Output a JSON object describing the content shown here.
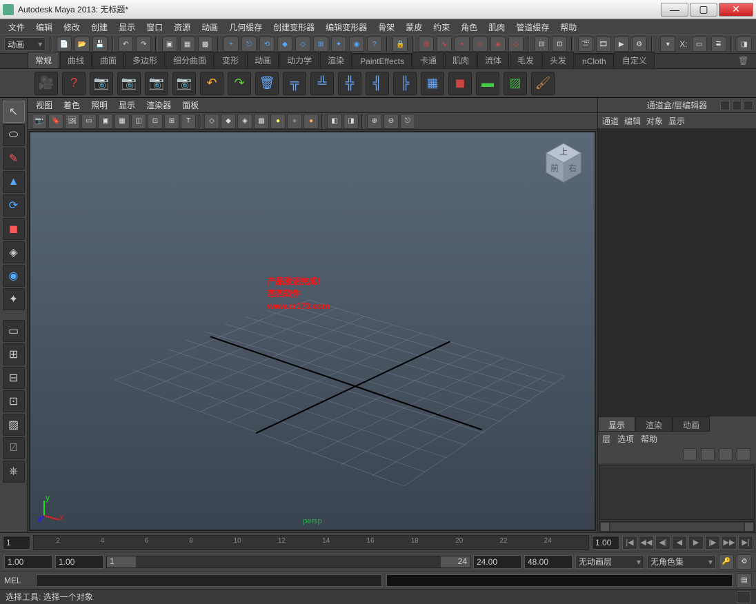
{
  "title": "Autodesk Maya 2013: 无标题*",
  "menu": [
    "文件",
    "编辑",
    "修改",
    "创建",
    "显示",
    "窗口",
    "资源",
    "动画",
    "几何缓存",
    "创建变形器",
    "编辑变形器",
    "骨架",
    "蒙皮",
    "约束",
    "角色",
    "肌肉",
    "管道缓存",
    "帮助"
  ],
  "modeCombo": "动画",
  "shelfTabs": [
    "常规",
    "曲线",
    "曲面",
    "多边形",
    "细分曲面",
    "变形",
    "动画",
    "动力学",
    "渲染",
    "PaintEffects",
    "卡通",
    "肌肉",
    "流体",
    "毛发",
    "头发",
    "nCloth",
    "自定义"
  ],
  "activeShelfTab": 0,
  "panelMenu": [
    "视图",
    "着色",
    "照明",
    "显示",
    "渲染器",
    "面板"
  ],
  "overlay": {
    "l1": "产品激活完成！",
    "l2": "西西软件",
    "l3": "www.cr173.com"
  },
  "perspLabel": "persp",
  "channelTitle": "通道盒/层编辑器",
  "channelTabs": [
    "通道",
    "编辑",
    "对象",
    "显示"
  ],
  "layerTabs": [
    "显示",
    "渲染",
    "动画"
  ],
  "activeLayerTab": 0,
  "layerMenu": [
    "层",
    "选项",
    "帮助"
  ],
  "timeline": {
    "start": "1",
    "end": "1.00",
    "ticks": [
      "2",
      "4",
      "6",
      "8",
      "10",
      "12",
      "14",
      "16",
      "18",
      "20",
      "22",
      "24"
    ]
  },
  "range": {
    "a": "1.00",
    "b": "1.00",
    "c": "1",
    "d": "24",
    "e": "24.00",
    "f": "48.00"
  },
  "animLayer": "无动画层",
  "charSet": "无角色集",
  "cmdLabel": "MEL",
  "status": "选择工具: 选择一个对象",
  "xlabel": "X:",
  "cubeFaces": {
    "top": "上",
    "front": "前",
    "right": "右"
  }
}
